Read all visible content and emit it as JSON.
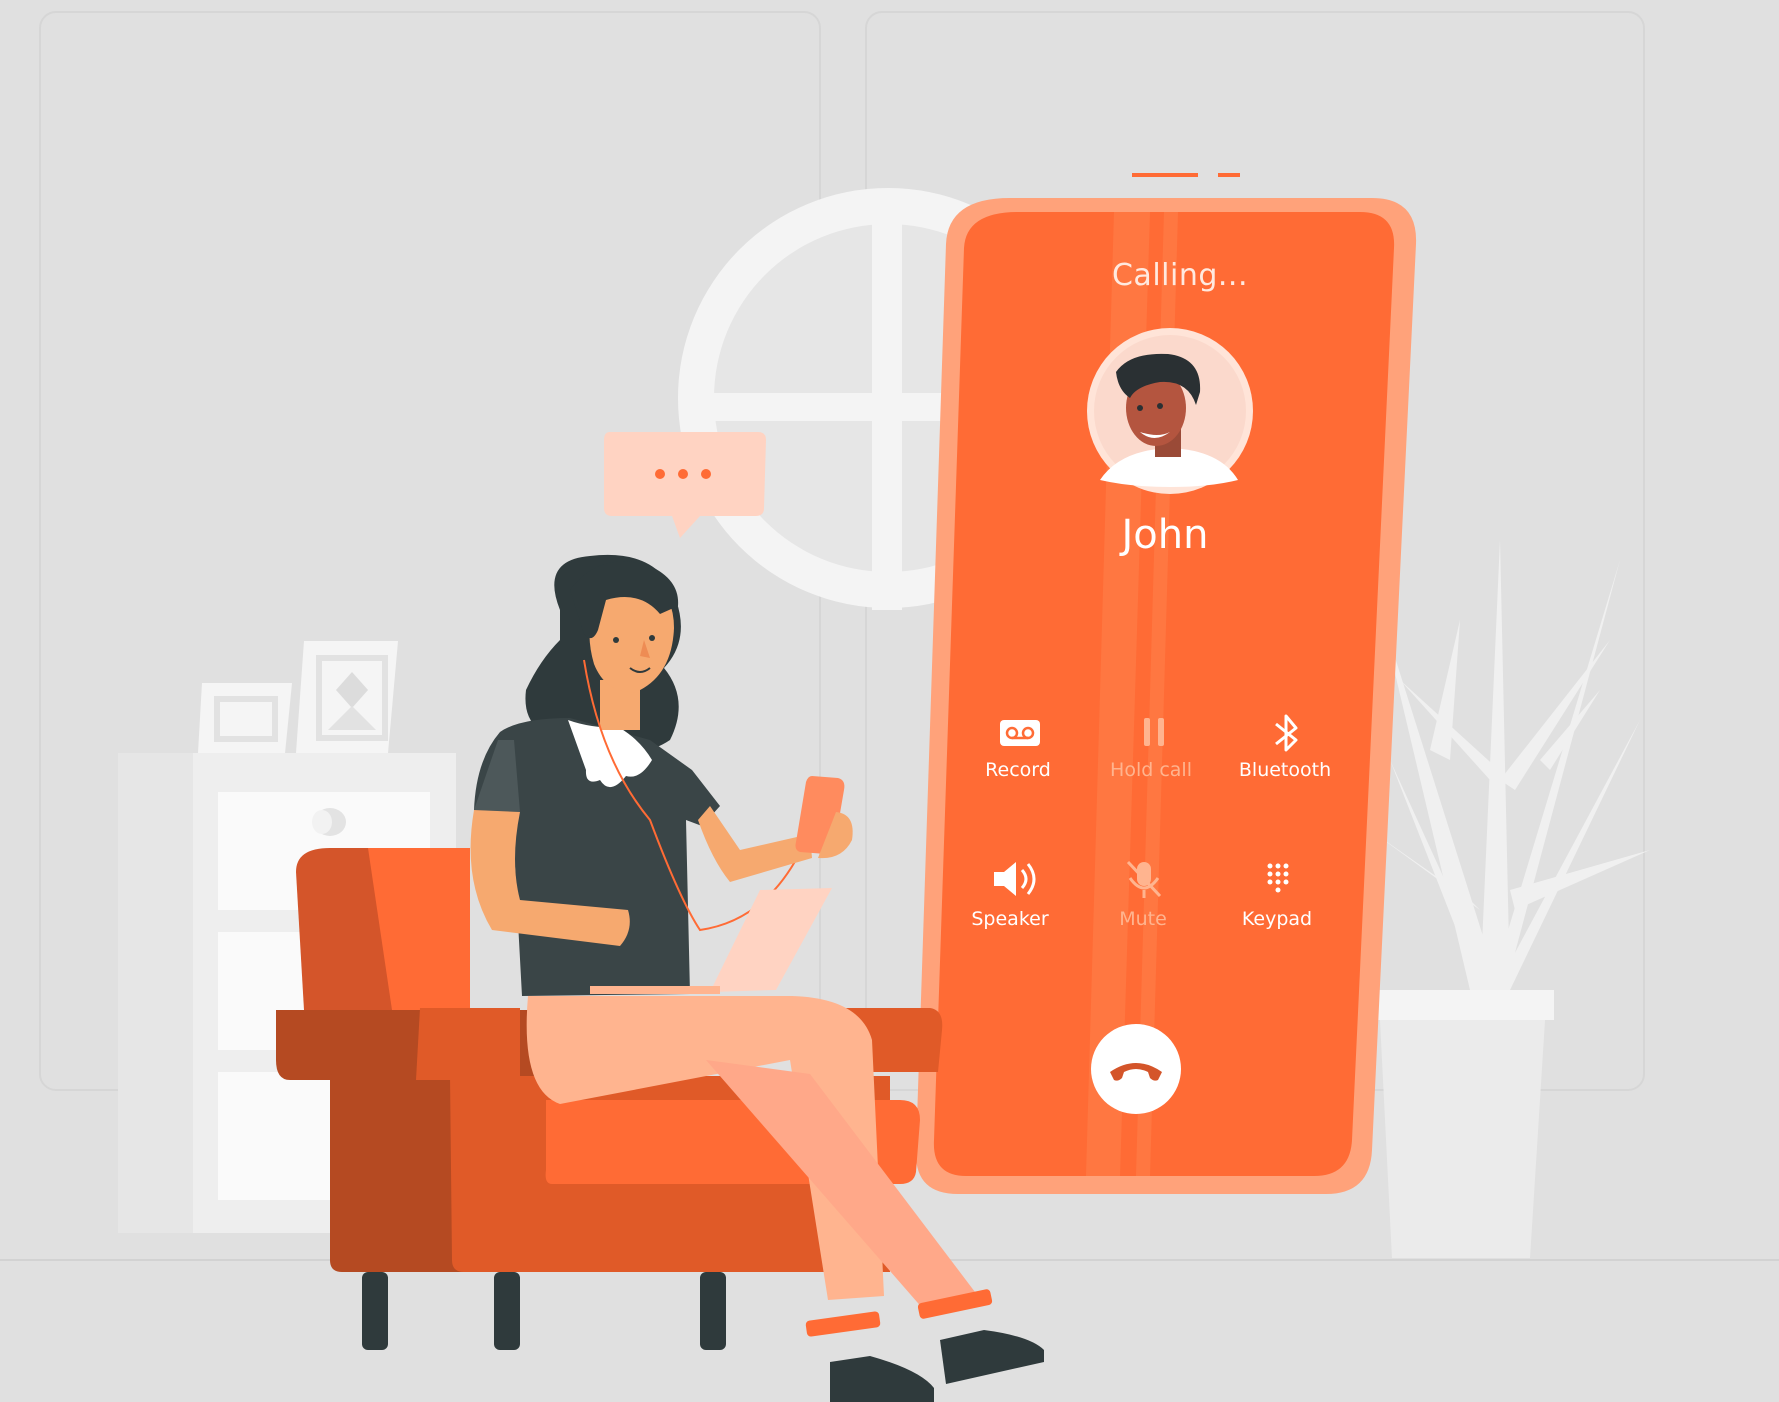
{
  "call": {
    "status": "Calling...",
    "contact_name": "John"
  },
  "controls": [
    {
      "id": "record",
      "label": "Record",
      "icon": "voicemail-icon",
      "enabled": true
    },
    {
      "id": "hold",
      "label": "Hold call",
      "icon": "pause-icon",
      "enabled": false
    },
    {
      "id": "bluetooth",
      "label": "Bluetooth",
      "icon": "bluetooth-icon",
      "enabled": true
    },
    {
      "id": "speaker",
      "label": "Speaker",
      "icon": "speaker-icon",
      "enabled": true
    },
    {
      "id": "mute",
      "label": "Mute",
      "icon": "mic-off-icon",
      "enabled": false
    },
    {
      "id": "keypad",
      "label": "Keypad",
      "icon": "keypad-icon",
      "enabled": true
    }
  ],
  "end_call": {
    "icon": "phone-hangup-icon"
  },
  "chat_bubble": {
    "icon": "typing-dots-icon"
  },
  "colors": {
    "background": "#e0e0e0",
    "accent": "#ff6b35",
    "accent_dark": "#e05a28",
    "accent_light": "#ffb48f",
    "skin": "#f6a96f",
    "dark": "#2f3a3c"
  }
}
